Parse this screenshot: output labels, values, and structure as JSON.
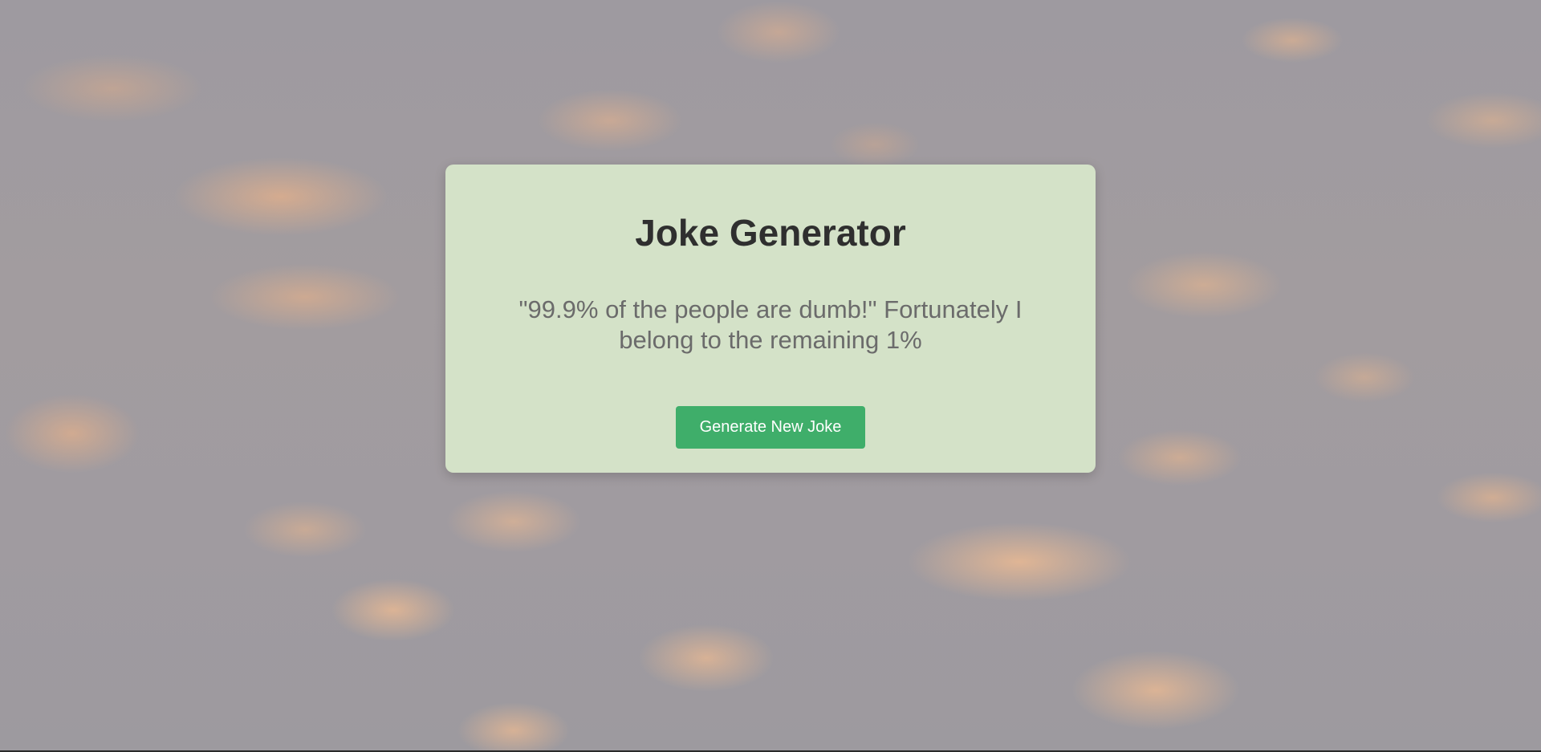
{
  "card": {
    "title": "Joke Generator",
    "joke": "\"99.9% of the people are dumb!\" Fortunately I belong to the remaining 1%",
    "button_label": "Generate New Joke"
  },
  "colors": {
    "card_background": "#d4e2c8",
    "button_background": "#3fae6a",
    "title_color": "#2f2f2f",
    "joke_color": "#6b6b6b"
  },
  "background": {
    "icon": "cloudy-sky-background"
  }
}
